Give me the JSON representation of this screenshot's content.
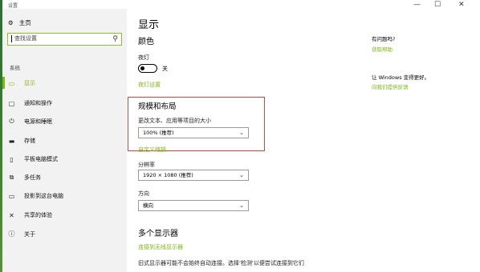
{
  "window": {
    "title": "设置",
    "controls": [
      "—",
      "☐",
      "✕"
    ]
  },
  "sidebar": {
    "home": "主页",
    "search_placeholder": "查找设置",
    "section": "系统",
    "items": [
      {
        "label": "显示",
        "icon": "monitor-icon"
      },
      {
        "label": "通知和操作",
        "icon": "notification-icon"
      },
      {
        "label": "电源和睡眠",
        "icon": "power-icon"
      },
      {
        "label": "存储",
        "icon": "storage-icon"
      },
      {
        "label": "平板电脑模式",
        "icon": "tablet-icon"
      },
      {
        "label": "多任务",
        "icon": "multitask-icon"
      },
      {
        "label": "投影到这台电脑",
        "icon": "project-icon"
      },
      {
        "label": "共享的体验",
        "icon": "share-icon"
      },
      {
        "label": "关于",
        "icon": "info-icon"
      }
    ]
  },
  "main": {
    "title": "显示",
    "color_heading": "颜色",
    "night_light_label": "夜灯",
    "night_light_state": "关",
    "night_light_settings": "夜灯设置",
    "scale_heading": "规模和布局",
    "scale_label": "更改文本、应用等项目的大小",
    "scale_value": "100% (推荐)",
    "custom_scale_link": "自定义缩放",
    "resolution_label": "分辨率",
    "resolution_value": "1920 × 1080 (推荐)",
    "orientation_label": "方向",
    "orientation_value": "横向",
    "multi_heading": "多个显示器",
    "wireless_link": "连接到无线显示器",
    "note": "旧式显示器可能不会始终自动连接。选择'检测'以便尝试连接到它们"
  },
  "right": {
    "question": "有问题吗?",
    "help_link": "获取帮助",
    "better": "让 Windows 变得更好。",
    "feedback_link": "向我们提供反馈"
  },
  "colors": {
    "accent": "#7cb814",
    "highlight_box": "#e0403a"
  }
}
